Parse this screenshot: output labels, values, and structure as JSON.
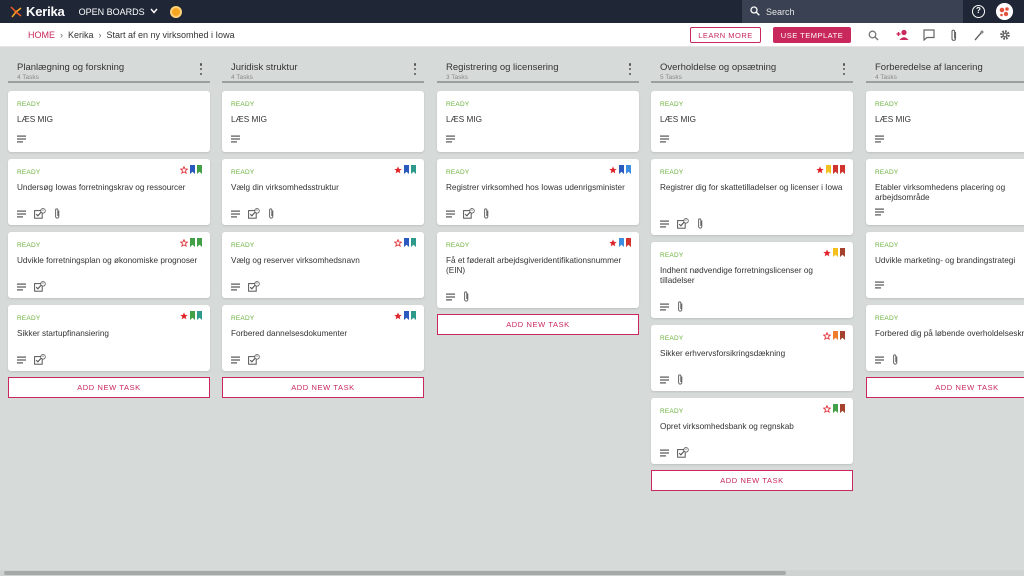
{
  "app": {
    "logo_text": "Kerika",
    "open_boards_label": "OPEN BOARDS",
    "search_placeholder": "Search",
    "help_label": "?"
  },
  "breadcrumb": {
    "home": "HOME",
    "items": [
      "Kerika",
      "Start af en ny virksomhed i Iowa"
    ]
  },
  "toolbar": {
    "learn_more": "LEARN MORE",
    "use_template": "USE TEMPLATE",
    "icons": [
      "search-icon",
      "add-person-icon",
      "chat-icon",
      "attachment-icon",
      "wand-icon",
      "gear-icon"
    ]
  },
  "colors": {
    "accent": "#c8285b",
    "status_ready": "#6ab03b",
    "topbar": "#1f2636",
    "board_bg": "#d6dbd9"
  },
  "add_task_label": "ADD NEW TASK",
  "columns": [
    {
      "title": "Planlægning og forskning",
      "count": "4 Tasks",
      "cards": [
        {
          "status": "READY",
          "title": "LÆS MIG",
          "icons": [
            "description"
          ],
          "flags": []
        },
        {
          "status": "READY",
          "title": "Undersøg Iowas forretningskrav og ressourcer",
          "icons": [
            "description",
            "checklist",
            "attachment"
          ],
          "checklist_count": "3",
          "flags": [
            "star-outline",
            "blue",
            "green"
          ]
        },
        {
          "status": "READY",
          "title": "Udvikle forretningsplan og økonomiske prognoser",
          "icons": [
            "description",
            "checklist"
          ],
          "checklist_count": "3",
          "flags": [
            "star-outline",
            "green",
            "green"
          ]
        },
        {
          "status": "READY",
          "title": "Sikker startupfinansiering",
          "icons": [
            "description",
            "checklist"
          ],
          "checklist_count": "3",
          "flags": [
            "star",
            "green",
            "teal"
          ]
        }
      ]
    },
    {
      "title": "Juridisk struktur",
      "count": "4 Tasks",
      "cards": [
        {
          "status": "READY",
          "title": "LÆS MIG",
          "icons": [
            "description"
          ],
          "flags": []
        },
        {
          "status": "READY",
          "title": "Vælg din virksomhedsstruktur",
          "icons": [
            "description",
            "checklist",
            "attachment"
          ],
          "checklist_count": "3",
          "flags": [
            "star",
            "blue",
            "teal"
          ]
        },
        {
          "status": "READY",
          "title": "Vælg og reserver virksomhedsnavn",
          "icons": [
            "description",
            "checklist"
          ],
          "checklist_count": "3",
          "flags": [
            "star-outline",
            "blue",
            "teal"
          ]
        },
        {
          "status": "READY",
          "title": "Forbered dannelsesdokumenter",
          "icons": [
            "description",
            "checklist"
          ],
          "checklist_count": "3",
          "flags": [
            "star",
            "blue",
            "teal"
          ]
        }
      ]
    },
    {
      "title": "Registrering og licensering",
      "count": "3 Tasks",
      "cards": [
        {
          "status": "READY",
          "title": "LÆS MIG",
          "icons": [
            "description"
          ],
          "flags": []
        },
        {
          "status": "READY",
          "title": "Registrer virksomhed hos Iowas udenrigsminister",
          "icons": [
            "description",
            "checklist",
            "attachment"
          ],
          "checklist_count": "3",
          "flags": [
            "star",
            "blue",
            "sky"
          ]
        },
        {
          "status": "READY",
          "title": "Få et føderalt arbejdsgiveridentifikationsnummer (EIN)",
          "icons": [
            "description",
            "attachment"
          ],
          "flags": [
            "star",
            "sky",
            "red"
          ]
        }
      ]
    },
    {
      "title": "Overholdelse og opsætning",
      "count": "5 Tasks",
      "cards": [
        {
          "status": "READY",
          "title": "LÆS MIG",
          "icons": [
            "description"
          ],
          "flags": []
        },
        {
          "status": "READY",
          "title": "Registrer dig for skattetilladelser og licenser i Iowa",
          "icons": [
            "description",
            "checklist",
            "attachment"
          ],
          "checklist_count": "3",
          "flags": [
            "star",
            "yellow",
            "red",
            "red"
          ]
        },
        {
          "status": "READY",
          "title": "Indhent nødvendige forretningslicenser og tilladelser",
          "icons": [
            "description",
            "attachment"
          ],
          "flags": [
            "star",
            "yellow",
            "brown"
          ]
        },
        {
          "status": "READY",
          "title": "Sikker erhvervsforsikringsdækning",
          "icons": [
            "description",
            "attachment"
          ],
          "flags": [
            "star-outline",
            "orange",
            "brown"
          ]
        },
        {
          "status": "READY",
          "title": "Opret virksomhedsbank og regnskab",
          "icons": [
            "description",
            "checklist"
          ],
          "checklist_count": "3",
          "flags": [
            "star-outline",
            "green",
            "brown"
          ]
        }
      ]
    },
    {
      "title": "Forberedelse af lancering",
      "count": "4 Tasks",
      "cards": [
        {
          "status": "READY",
          "title": "LÆS MIG",
          "icons": [
            "description"
          ],
          "flags": []
        },
        {
          "status": "READY",
          "title": "Etabler virksomhedens placering og arbejdsområde",
          "icons": [
            "description"
          ],
          "flags": []
        },
        {
          "status": "READY",
          "title": "Udvikle marketing- og brandingstrategi",
          "icons": [
            "description"
          ],
          "flags": []
        },
        {
          "status": "READY",
          "title": "Forbered dig på løbende overholdelseskrav",
          "icons": [
            "description",
            "attachment"
          ],
          "flags": []
        }
      ]
    }
  ]
}
